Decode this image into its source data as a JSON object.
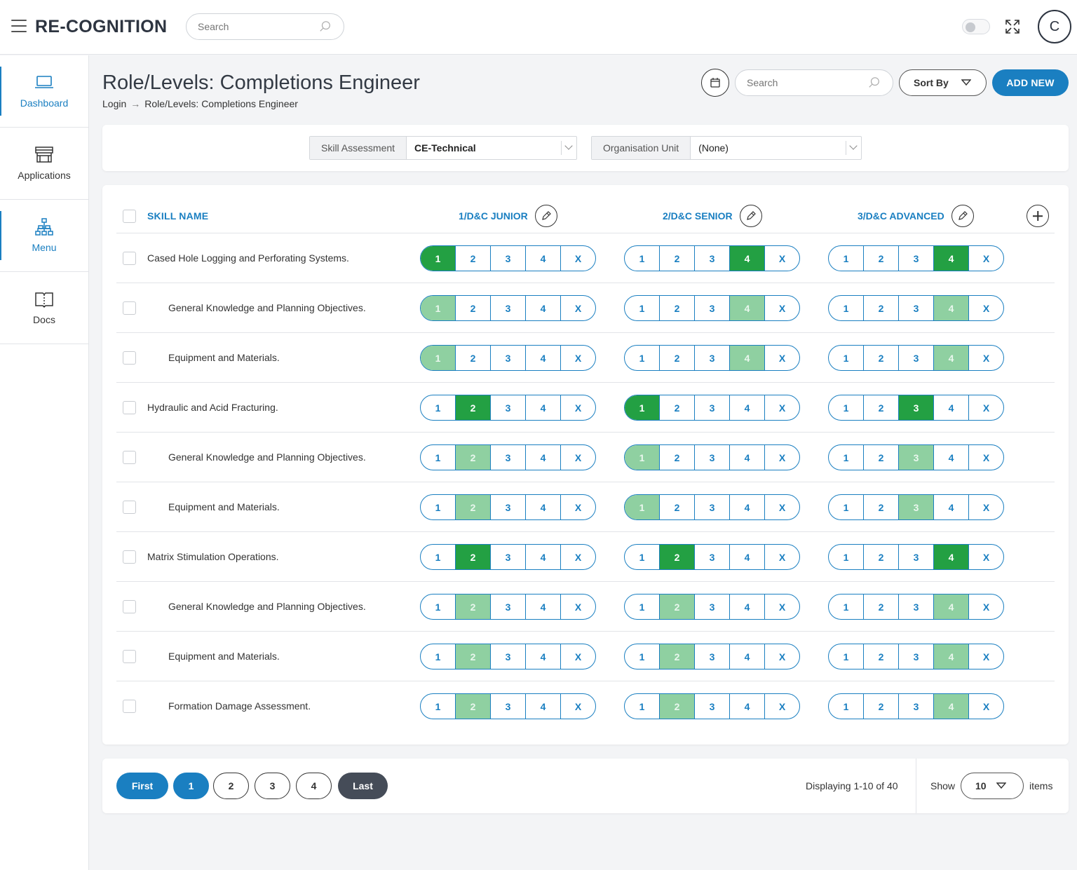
{
  "app": {
    "title": "RE-COGNITION",
    "avatar_initial": "C"
  },
  "topbar": {
    "search_placeholder": "Search"
  },
  "sidebar": {
    "items": [
      {
        "label": "Dashboard",
        "icon": "laptop-icon"
      },
      {
        "label": "Applications",
        "icon": "store-icon"
      },
      {
        "label": "Menu",
        "icon": "sitemap-icon"
      },
      {
        "label": "Docs",
        "icon": "book-icon"
      }
    ]
  },
  "page": {
    "title": "Role/Levels: Completions Engineer",
    "breadcrumb": [
      "Login",
      "Role/Levels: Completions Engineer"
    ],
    "search_placeholder": "Search",
    "sort_label": "Sort By",
    "add_label": "ADD NEW"
  },
  "filters": {
    "skill_assessment_label": "Skill Assessment",
    "skill_assessment_value": "CE-Technical",
    "org_unit_label": "Organisation Unit",
    "org_unit_value": "(None)"
  },
  "table": {
    "skill_header": "SKILL NAME",
    "levels": [
      "1/D&C JUNIOR",
      "2/D&C SENIOR",
      "3/D&C ADVANCED"
    ],
    "options": [
      "1",
      "2",
      "3",
      "4",
      "X"
    ],
    "rows": [
      {
        "name": "Cased Hole Logging and Perforating Systems.",
        "indent": 0,
        "selected": [
          {
            "i": 0,
            "s": "on"
          },
          {
            "i": 3,
            "s": "on"
          },
          {
            "i": 3,
            "s": "on"
          }
        ]
      },
      {
        "name": "General Knowledge and Planning Objectives.",
        "indent": 1,
        "selected": [
          {
            "i": 0,
            "s": "lt"
          },
          {
            "i": 3,
            "s": "lt"
          },
          {
            "i": 3,
            "s": "lt"
          }
        ]
      },
      {
        "name": "Equipment and Materials.",
        "indent": 1,
        "selected": [
          {
            "i": 0,
            "s": "lt"
          },
          {
            "i": 3,
            "s": "lt"
          },
          {
            "i": 3,
            "s": "lt"
          }
        ]
      },
      {
        "name": "Hydraulic and Acid Fracturing.",
        "indent": 0,
        "selected": [
          {
            "i": 1,
            "s": "on"
          },
          {
            "i": 0,
            "s": "on"
          },
          {
            "i": 2,
            "s": "on"
          }
        ]
      },
      {
        "name": "General Knowledge and Planning Objectives.",
        "indent": 1,
        "selected": [
          {
            "i": 1,
            "s": "lt"
          },
          {
            "i": 0,
            "s": "lt"
          },
          {
            "i": 2,
            "s": "lt"
          }
        ]
      },
      {
        "name": "Equipment and Materials.",
        "indent": 1,
        "selected": [
          {
            "i": 1,
            "s": "lt"
          },
          {
            "i": 0,
            "s": "lt"
          },
          {
            "i": 2,
            "s": "lt"
          }
        ]
      },
      {
        "name": "Matrix Stimulation Operations.",
        "indent": 0,
        "selected": [
          {
            "i": 1,
            "s": "on"
          },
          {
            "i": 1,
            "s": "on"
          },
          {
            "i": 3,
            "s": "on"
          }
        ]
      },
      {
        "name": "General Knowledge and Planning Objectives.",
        "indent": 1,
        "selected": [
          {
            "i": 1,
            "s": "lt"
          },
          {
            "i": 1,
            "s": "lt"
          },
          {
            "i": 3,
            "s": "lt"
          }
        ]
      },
      {
        "name": "Equipment and Materials.",
        "indent": 1,
        "selected": [
          {
            "i": 1,
            "s": "lt"
          },
          {
            "i": 1,
            "s": "lt"
          },
          {
            "i": 3,
            "s": "lt"
          }
        ]
      },
      {
        "name": "Formation Damage Assessment.",
        "indent": 1,
        "selected": [
          {
            "i": 1,
            "s": "lt"
          },
          {
            "i": 1,
            "s": "lt"
          },
          {
            "i": 3,
            "s": "lt"
          }
        ]
      }
    ]
  },
  "pagination": {
    "first_label": "First",
    "last_label": "Last",
    "pages": [
      "1",
      "2",
      "3",
      "4"
    ],
    "current_page": "1",
    "displaying": "Displaying 1-10 of 40",
    "show_label": "Show",
    "page_size": "10",
    "items_label": "items"
  },
  "colors": {
    "accent": "#1a7fc1",
    "selected": "#23a043",
    "selected_light": "#8fd0a1",
    "dark_button": "#454c58"
  }
}
